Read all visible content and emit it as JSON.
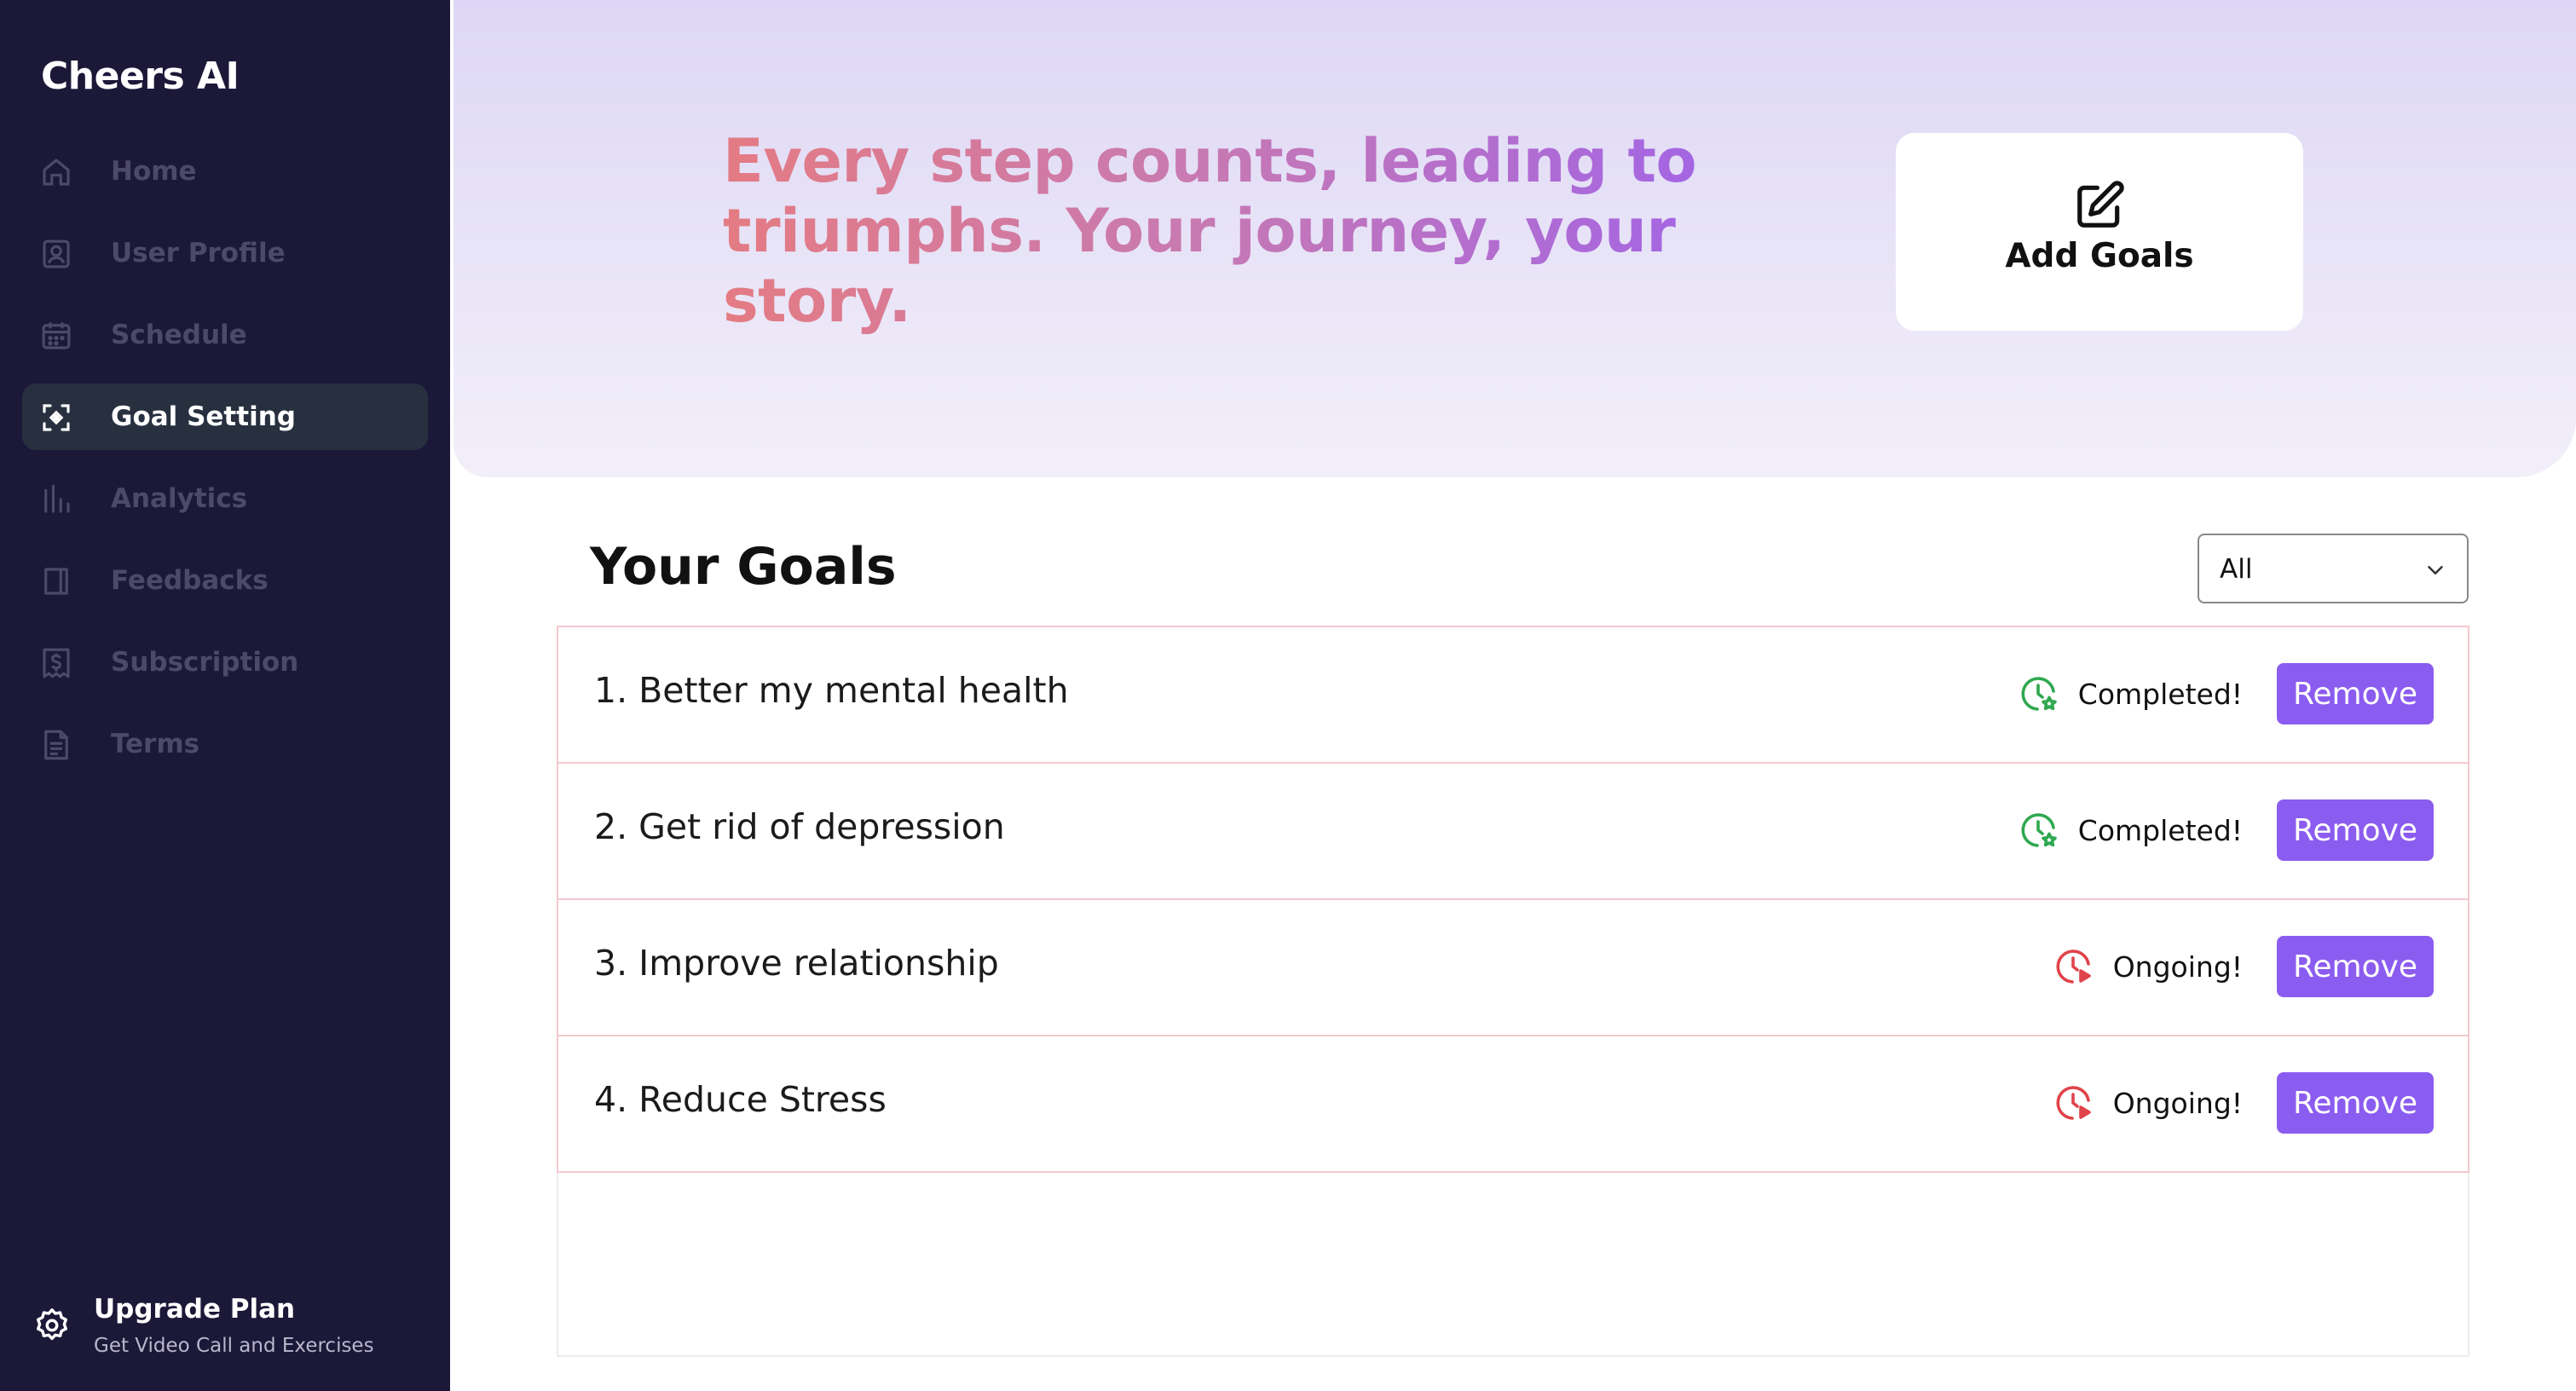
{
  "app": {
    "brand": "Cheers AI"
  },
  "sidebar": {
    "items": [
      {
        "label": "Home",
        "icon": "home-icon",
        "active": false
      },
      {
        "label": "User Profile",
        "icon": "user-profile-icon",
        "active": false
      },
      {
        "label": "Schedule",
        "icon": "calendar-icon",
        "active": false
      },
      {
        "label": "Goal Setting",
        "icon": "target-icon",
        "active": true
      },
      {
        "label": "Analytics",
        "icon": "bar-chart-icon",
        "active": false
      },
      {
        "label": "Feedbacks",
        "icon": "book-icon",
        "active": false
      },
      {
        "label": "Subscription",
        "icon": "dollar-receipt-icon",
        "active": false
      },
      {
        "label": "Terms",
        "icon": "document-icon",
        "active": false
      }
    ],
    "upgrade": {
      "title": "Upgrade Plan",
      "subtitle": "Get Video Call and Exercises",
      "icon": "gear-icon"
    }
  },
  "hero": {
    "headline": "Every step counts, leading to triumphs. Your journey, your story.",
    "add_goals_label": "Add Goals",
    "add_goals_icon": "edit-icon"
  },
  "goals": {
    "title": "Your Goals",
    "filter": {
      "selected": "All",
      "icon": "chevron-down-icon"
    },
    "remove_label": "Remove",
    "items": [
      {
        "name": "1. Better my mental health",
        "status": "Completed!",
        "status_type": "completed"
      },
      {
        "name": "2. Get rid of depression",
        "status": "Completed!",
        "status_type": "completed"
      },
      {
        "name": "3. Improve relationship",
        "status": "Ongoing!",
        "status_type": "ongoing"
      },
      {
        "name": "4. Reduce Stress",
        "status": "Ongoing!",
        "status_type": "ongoing"
      }
    ]
  },
  "colors": {
    "sidebar_bg": "#1c1838",
    "active_item_bg": "#283040",
    "accent": "#8b5cf0",
    "completed": "#2fa84f",
    "ongoing": "#e0434a",
    "row_border": "#f3c8cf"
  }
}
